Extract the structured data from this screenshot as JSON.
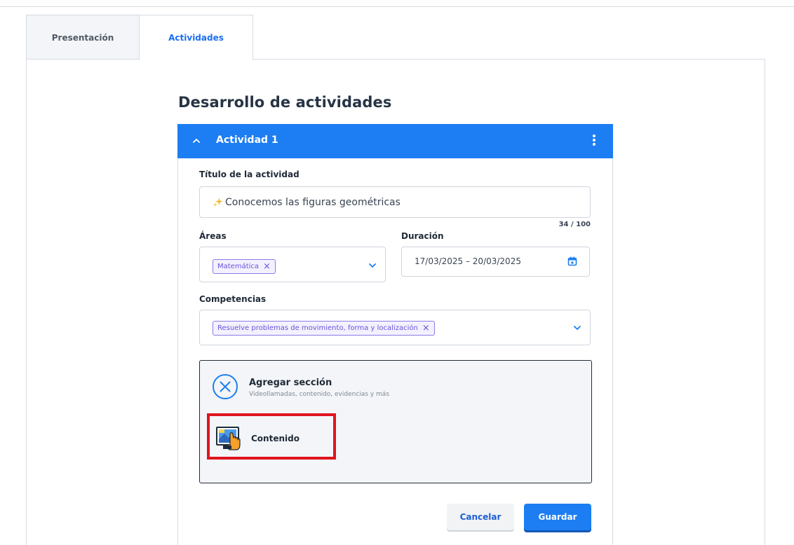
{
  "tabs": [
    {
      "label": "Presentación",
      "active": false
    },
    {
      "label": "Actividades",
      "active": true
    }
  ],
  "page_title": "Desarrollo de actividades",
  "activity": {
    "title": "Actividad 1",
    "header_color": "#1c7ef2",
    "form": {
      "title_label": "Título de la actividad",
      "title_value": "Conocemos las figuras geométricas",
      "title_counter": "34 / 100",
      "areas_label": "Áreas",
      "areas_chip": "Matemática",
      "duration_label": "Duración",
      "duration_value": "17/03/2025  –  20/03/2025",
      "competencias_label": "Competencias",
      "competencias_chip": "Resuelve problemas de movimiento, forma y localización"
    },
    "add_section": {
      "title": "Agregar sección",
      "subtitle": "Videollamadas, contenido, evidencias y más",
      "option_label": "Contenido",
      "highlight_color": "#e0141f"
    }
  },
  "buttons": {
    "cancel": "Cancelar",
    "save": "Guardar"
  },
  "icons": {
    "accordion_toggle": "chevron-up-icon",
    "menu": "kebab-menu-icon",
    "title_prefix": "sparkle-icon",
    "dropdown": "chevron-down-icon",
    "date": "calendar-icon",
    "chip_remove": "close-icon",
    "add_section_toggle": "close-circle-icon",
    "content_option": "content-touch-icon"
  }
}
